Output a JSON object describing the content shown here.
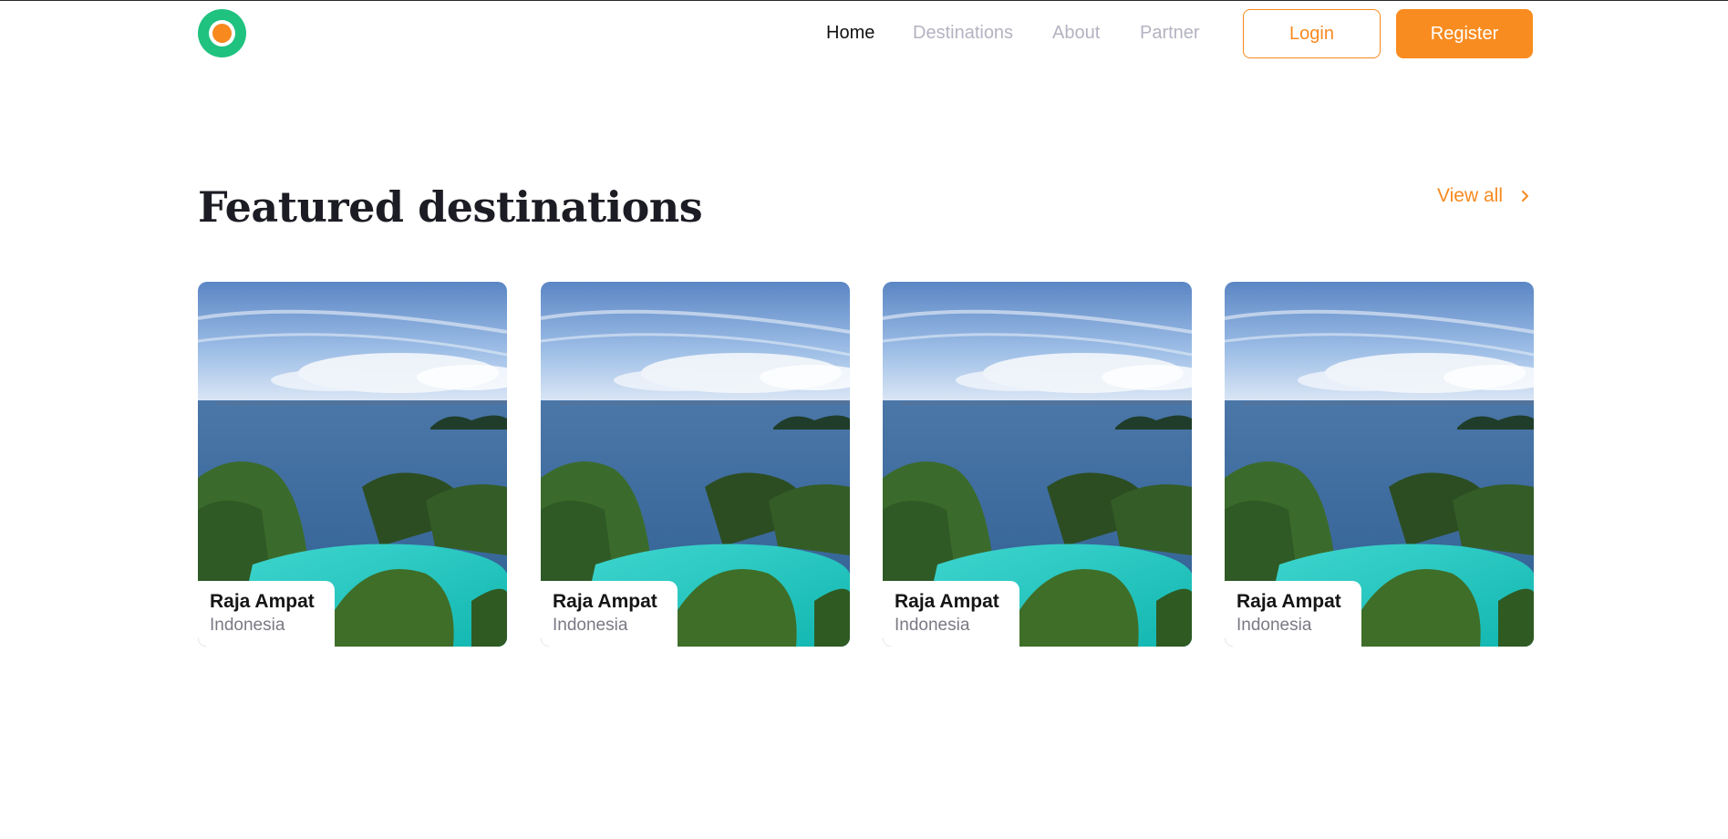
{
  "header": {
    "logo_icon": "ring-logo-icon",
    "nav": [
      {
        "label": "Home",
        "active": true
      },
      {
        "label": "Destinations",
        "active": false
      },
      {
        "label": "About",
        "active": false
      },
      {
        "label": "Partner",
        "active": false
      }
    ],
    "login_label": "Login",
    "register_label": "Register"
  },
  "featured": {
    "title": "Featured destinations",
    "view_all_label": "View all",
    "view_all_icon": "chevron-right-icon",
    "cards": [
      {
        "name": "Raja Ampat",
        "country": "Indonesia"
      },
      {
        "name": "Raja Ampat",
        "country": "Indonesia"
      },
      {
        "name": "Raja Ampat",
        "country": "Indonesia"
      },
      {
        "name": "Raja Ampat",
        "country": "Indonesia"
      }
    ]
  },
  "colors": {
    "accent": "#f7891f",
    "logo_green": "#1fc27f",
    "text_dark": "#1c1c24",
    "nav_inactive": "#b3b3c2"
  }
}
